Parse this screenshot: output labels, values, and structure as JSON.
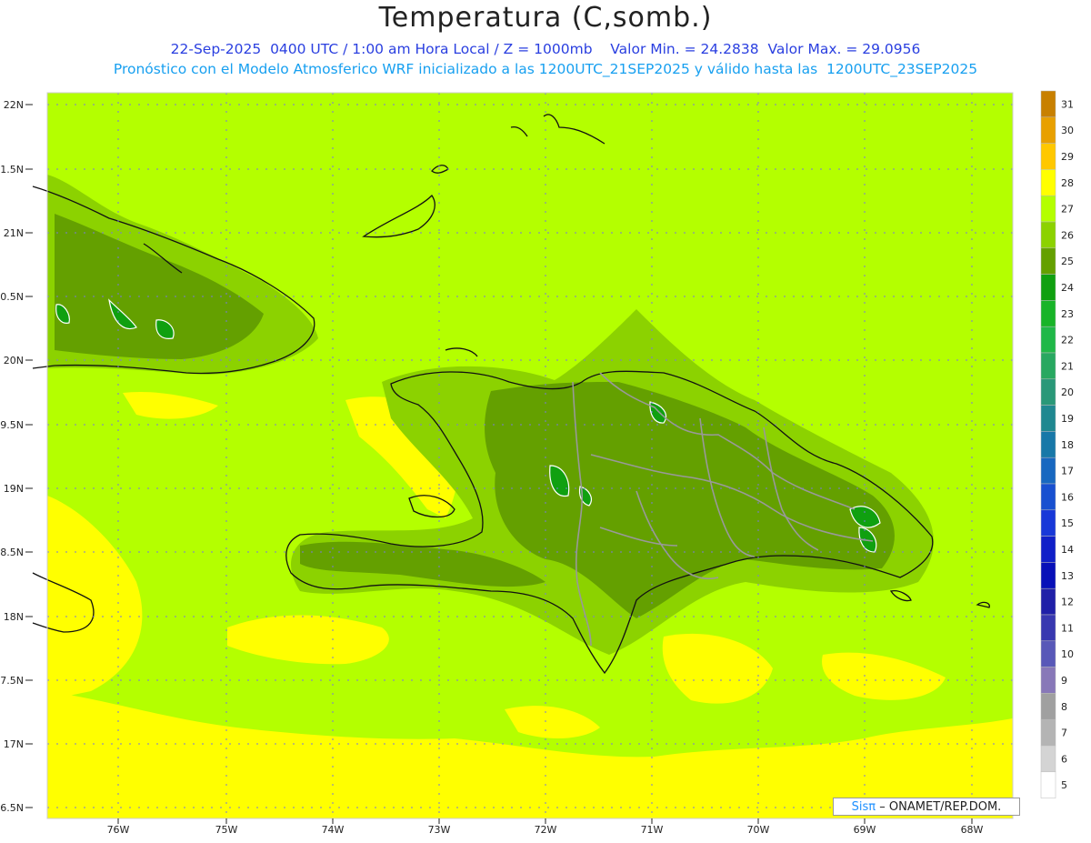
{
  "header": {
    "title": "Temperatura (C,somb.)",
    "line1_left": "22-Sep-2025  0400 UTC / 1:00 am Hora Local / Z = 1000mb",
    "line1_right": "Valor Min. = 24.2838  Valor Max. = 29.0956",
    "line2": "Pronóstico con el Modelo Atmosferico WRF inicializado a las 1200UTC_21SEP2025 y válido hasta las  1200UTC_23SEP2025"
  },
  "axes": {
    "lat_labels": [
      "22N",
      "1.5N",
      "21N",
      "0.5N",
      "20N",
      "9.5N",
      "19N",
      "8.5N",
      "18N",
      "7.5N",
      "17N",
      "6.5N"
    ],
    "lon_labels": [
      "76W",
      "75W",
      "74W",
      "73W",
      "72W",
      "71W",
      "70W",
      "69W",
      "68W"
    ]
  },
  "colorbar": {
    "labels": [
      "31",
      "30",
      "29",
      "28",
      "27",
      "26",
      "25",
      "24",
      "23",
      "22",
      "21",
      "20",
      "19",
      "18",
      "17",
      "16",
      "15",
      "14",
      "13",
      "12",
      "11",
      "10",
      "9",
      "8",
      "7",
      "6",
      "5"
    ],
    "colors": [
      "#c88000",
      "#e8a000",
      "#ffc800",
      "#ffff00",
      "#b4ff00",
      "#8cd200",
      "#64a000",
      "#10a010",
      "#18b428",
      "#20b848",
      "#28a860",
      "#2a9878",
      "#208890",
      "#1878a8",
      "#1868c0",
      "#1850d0",
      "#1838d8",
      "#1020c8",
      "#0810b8",
      "#2020a8",
      "#3838b0",
      "#5858b8",
      "#8878b8",
      "#a0a0a0",
      "#b4b4b4",
      "#d4d4d4",
      "#ffffff"
    ]
  },
  "credit": {
    "sis": "Sisπ",
    "rest": "– ONAMET/REP.DOM."
  },
  "colors": {
    "base": "#b4ff00",
    "warm": "#ffff00",
    "mid": "#8cd200",
    "cool": "#64a000",
    "green": "#10a010",
    "border": "#888888"
  }
}
